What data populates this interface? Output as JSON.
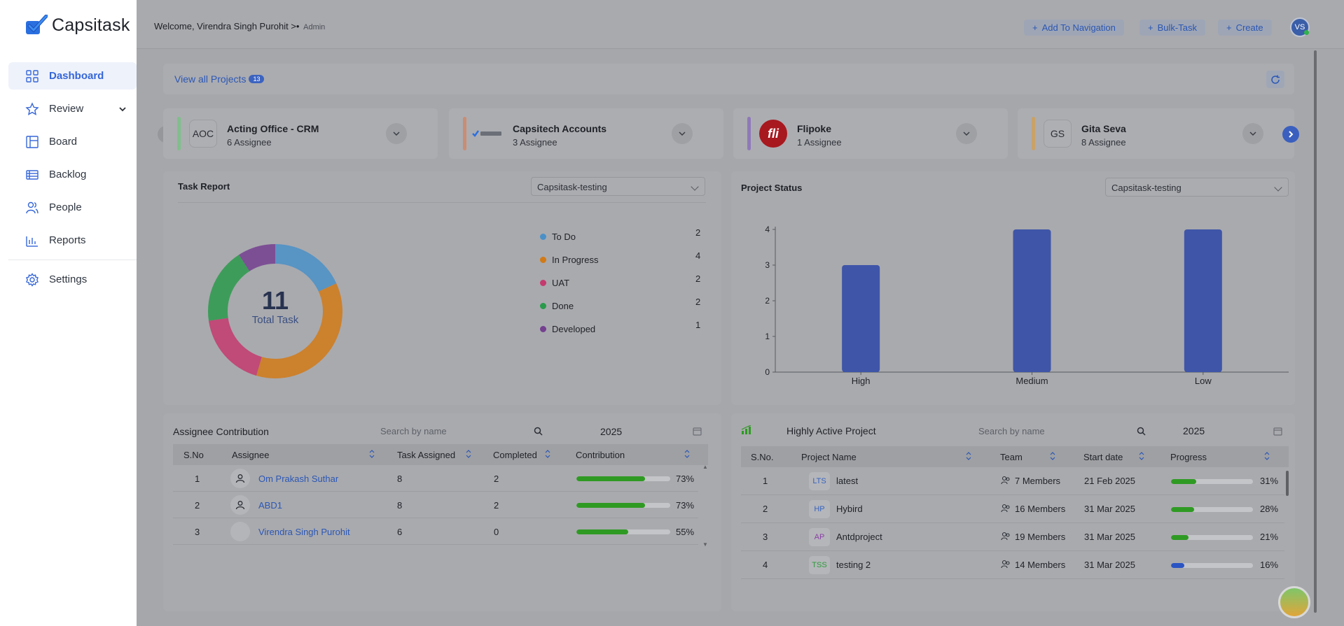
{
  "app": {
    "brand": "Capsitask"
  },
  "sidebar": {
    "items": [
      {
        "label": "Dashboard",
        "icon": "grid-icon",
        "active": true
      },
      {
        "label": "Review",
        "icon": "star-icon"
      },
      {
        "label": "Board",
        "icon": "board-icon"
      },
      {
        "label": "Backlog",
        "icon": "backlog-icon"
      },
      {
        "label": "People",
        "icon": "people-icon"
      },
      {
        "label": "Reports",
        "icon": "bar-chart-icon"
      }
    ],
    "settings": {
      "label": "Settings",
      "icon": "gear-icon"
    }
  },
  "header": {
    "welcome": "Welcome, Virendra Singh Purohit >•",
    "role": "Admin",
    "buttons": {
      "add_nav": "Add To Navigation",
      "bulk": "Bulk-Task",
      "create": "Create"
    },
    "avatar_initials": "VS"
  },
  "projects_bar": {
    "view_all": "View all Projects",
    "count": "13"
  },
  "project_cards": [
    {
      "code": "AOC",
      "name": "Acting Office - CRM",
      "assignees": "6 Assignee",
      "stripe": "#7fbf8a"
    },
    {
      "code": "",
      "name": "Capsitech Accounts",
      "assignees": "3 Assignee",
      "stripe": "#c98d74"
    },
    {
      "code": "fli",
      "name": "Flipoke",
      "assignees": "1 Assignee",
      "stripe": "#8f79b8"
    },
    {
      "code": "GS",
      "name": "Gita Seva",
      "assignees": "8 Assignee",
      "stripe": "#c9a266"
    }
  ],
  "task_report": {
    "title": "Task Report",
    "project_select": "Capsitask-testing",
    "total": "11",
    "total_label": "Total Task",
    "legend": [
      {
        "label": "To Do",
        "value": "2",
        "color": "#4a90c8"
      },
      {
        "label": "In Progress",
        "value": "4",
        "color": "#d27a16"
      },
      {
        "label": "UAT",
        "value": "2",
        "color": "#c43a6f"
      },
      {
        "label": "Done",
        "value": "2",
        "color": "#2a9a4b"
      },
      {
        "label": "Developed",
        "value": "1",
        "color": "#74408f"
      }
    ]
  },
  "project_status": {
    "title": "Project Status",
    "project_select": "Capsitask-testing"
  },
  "chart_data": {
    "type": "bar",
    "categories": [
      "High",
      "Medium",
      "Low"
    ],
    "values": [
      3,
      4,
      4
    ],
    "ylim": [
      0,
      4
    ],
    "yticks": [
      "0",
      "1",
      "2",
      "3",
      "4"
    ],
    "bar_color": "#3f55a8",
    "grid": false,
    "title": "",
    "xlabel": "",
    "ylabel": ""
  },
  "assignee_contribution": {
    "title": "Assignee Contribution",
    "search_placeholder": "Search by name",
    "year": "2025",
    "columns": [
      "S.No",
      "Assignee",
      "Task Assigned",
      "Completed",
      "Contribution"
    ],
    "rows": [
      {
        "sno": "1",
        "name": "Om Prakash Suthar",
        "assigned": "8",
        "completed": "2",
        "pct": "73%",
        "fraction": 0.73
      },
      {
        "sno": "2",
        "name": "ABD1",
        "assigned": "8",
        "completed": "2",
        "pct": "73%",
        "fraction": 0.73
      },
      {
        "sno": "3",
        "name": "Virendra Singh Purohit",
        "assigned": "6",
        "completed": "0",
        "pct": "55%",
        "fraction": 0.55
      }
    ]
  },
  "active_projects": {
    "title": "Highly Active Project",
    "search_placeholder": "Search by name",
    "year": "2025",
    "columns": [
      "S.No.",
      "Project Name",
      "Team",
      "Start date",
      "Progress"
    ],
    "rows": [
      {
        "sno": "1",
        "code": "LTS",
        "code_color": "#3563c0",
        "name": "latest",
        "team": "7 Members",
        "start": "21 Feb 2025",
        "pct": "31%",
        "fraction": 0.31,
        "bar": "#2f9a23"
      },
      {
        "sno": "2",
        "code": "HP",
        "code_color": "#3563c0",
        "name": "Hybird",
        "team": "16 Members",
        "start": "31 Mar 2025",
        "pct": "28%",
        "fraction": 0.28,
        "bar": "#2f9a23"
      },
      {
        "sno": "3",
        "code": "AP",
        "code_color": "#8a3fa5",
        "name": "Antdproject",
        "team": "19 Members",
        "start": "31 Mar 2025",
        "pct": "21%",
        "fraction": 0.21,
        "bar": "#2f9a23"
      },
      {
        "sno": "4",
        "code": "TSS",
        "code_color": "#2d9a3a",
        "name": "testing 2",
        "team": "14 Members",
        "start": "31 Mar 2025",
        "pct": "16%",
        "fraction": 0.16,
        "bar": "#2b55c4"
      }
    ]
  }
}
